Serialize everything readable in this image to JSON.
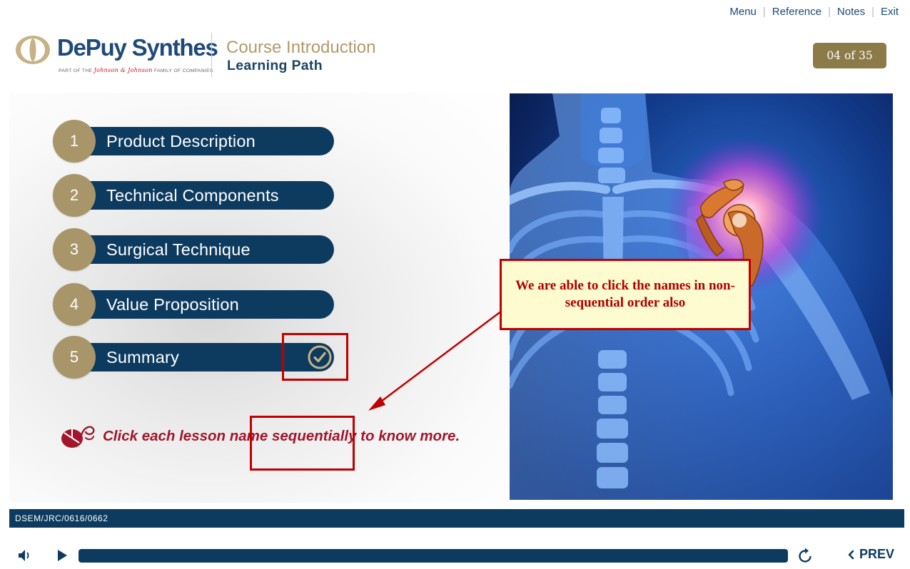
{
  "nav": {
    "items": [
      "Menu",
      "Reference",
      "Notes",
      "Exit"
    ]
  },
  "logo": {
    "wordmark": "DePuy Synthes",
    "sub_prefix": "PART OF THE",
    "sub_brand": "Johnson & Johnson",
    "sub_suffix": "FAMILY OF COMPANIES"
  },
  "header": {
    "course_title": "Course Introduction",
    "course_subtitle": "Learning Path",
    "page_counter": "04 of 35"
  },
  "lessons": [
    {
      "number": "1",
      "label": "Product Description",
      "completed": false
    },
    {
      "number": "2",
      "label": "Technical Components",
      "completed": false
    },
    {
      "number": "3",
      "label": "Surgical Technique",
      "completed": false
    },
    {
      "number": "4",
      "label": "Value Proposition",
      "completed": false
    },
    {
      "number": "5",
      "label": "Summary",
      "completed": true
    }
  ],
  "instruction": {
    "text": "Click each lesson name sequentially to know more.",
    "icon": "mouse-click-icon"
  },
  "annotation": {
    "callout_text": "We are able to click the names in non-sequential order also",
    "color": "#c00000"
  },
  "image": {
    "subject": "shoulder-anatomy-illustration"
  },
  "footer": {
    "code": "DSEM/JRC/0616/0662"
  },
  "player": {
    "prev_label": "PREV",
    "icons": [
      "volume-icon",
      "play-icon",
      "replay-icon",
      "chevron-left-icon"
    ]
  },
  "colors": {
    "navy": "#0d3b60",
    "gold": "#a8966a",
    "counter_bg": "#8c7b48",
    "instruction_red": "#a3152b"
  }
}
